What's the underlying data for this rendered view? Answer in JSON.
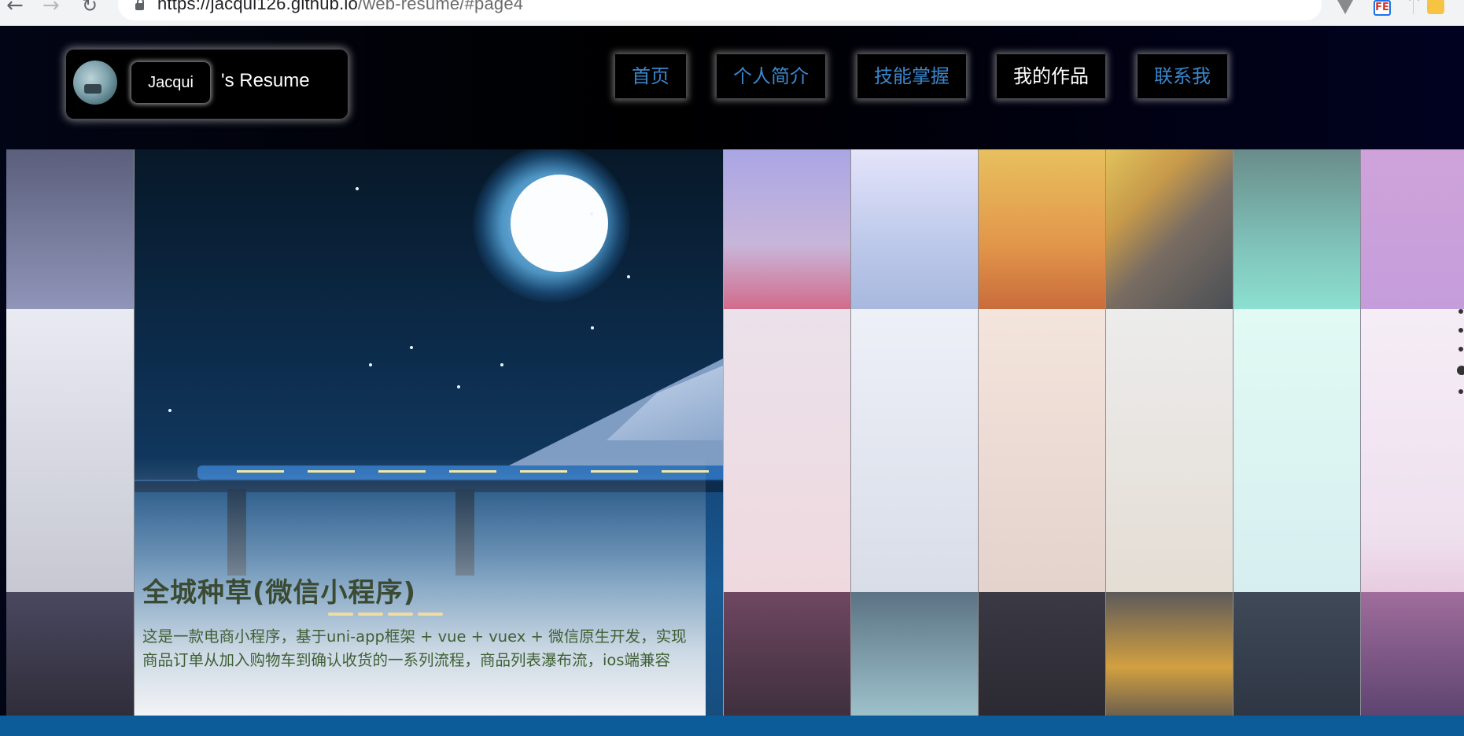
{
  "browser": {
    "url_host": "https://jacqui126.github.io",
    "url_path": "/web-resume/#page4",
    "icons": [
      "back-arrow-icon",
      "forward-arrow-icon",
      "reload-icon",
      "lock-icon",
      "bookmark-star-icon",
      "extension-icon",
      "fe-extension-icon",
      "avatar-extension-icon"
    ]
  },
  "header": {
    "name": "Jacqui",
    "suffix": "'s Resume"
  },
  "nav": {
    "items": [
      {
        "label": "首页"
      },
      {
        "label": "个人简介"
      },
      {
        "label": "技能掌握"
      },
      {
        "label": "我的作品"
      },
      {
        "label": "联系我"
      }
    ],
    "active_index": 3,
    "colors": {
      "link": "#3a86cc",
      "active": "#ffffff"
    }
  },
  "work": {
    "title": "全城种草(微信小程序)",
    "description": "这是一款电商小程序，基于uni-app框架 + vue + vuex + 微信原生开发，实现商品订单从加入购物车到确认收货的一系列流程，商品列表瀑布流，ios端兼容"
  },
  "pager": {
    "count": 5,
    "active_index": 3
  }
}
